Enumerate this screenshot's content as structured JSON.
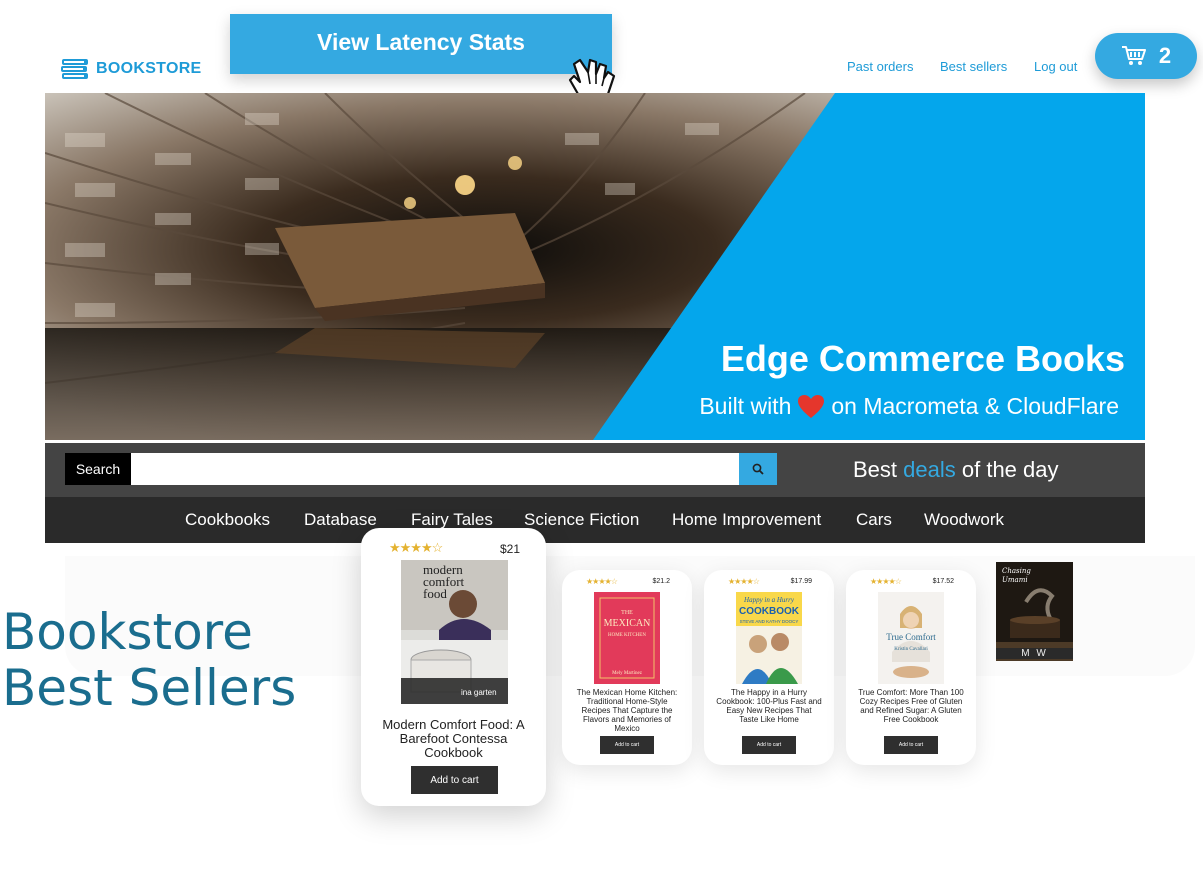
{
  "header": {
    "logo_text": "BOOKSTORE",
    "latency_button": "View Latency Stats",
    "nav": [
      "Past orders",
      "Best sellers",
      "Log out"
    ],
    "cart_count": "2"
  },
  "hero": {
    "title": "Edge Commerce Books",
    "subtitle_prefix": "Built with",
    "subtitle_suffix": "on Macrometa & CloudFlare"
  },
  "search": {
    "label": "Search",
    "placeholder": "",
    "deals_prefix": "Best",
    "deals_highlight": "deals",
    "deals_suffix": "of the day"
  },
  "categories": [
    "Cookbooks",
    "Database",
    "Fairy Tales",
    "Science Fiction",
    "Home Improvement",
    "Cars",
    "Woodwork"
  ],
  "section_title": [
    "Bookstore",
    "Best Sellers"
  ],
  "books": [
    {
      "title": "Modern Comfort Food: A Barefoot Contessa Cookbook",
      "price": "$21",
      "stars": "★★★★☆",
      "add_label": "Add to cart",
      "cover_lines": [
        "modern",
        "comfort",
        "food"
      ],
      "cover_author": "ina garten"
    },
    {
      "title": "The Mexican Home Kitchen: Traditional Home-Style Recipes That Capture the Flavors and Memories of Mexico",
      "price": "$21.2",
      "stars": "★★★★☆",
      "add_label": "Add to cart",
      "cover_lines": [
        "THE",
        "MEXICAN",
        "HOME KITCHEN"
      ],
      "cover_author": "Mely Martínez"
    },
    {
      "title": "The Happy in a Hurry Cookbook: 100-Plus Fast and Easy New Recipes That Taste Like Home",
      "price": "$17.99",
      "stars": "★★★★☆",
      "add_label": "Add to cart",
      "cover_lines": [
        "Happy in a Hurry",
        "COOKBOOK",
        "STEVE AND KATHY DOOCY"
      ],
      "cover_author": ""
    },
    {
      "title": "True Comfort: More Than 100 Cozy Recipes Free of Gluten and Refined Sugar: A Gluten Free Cookbook",
      "price": "$17.52",
      "stars": "★★★★☆",
      "add_label": "Add to cart",
      "cover_lines": [
        "True Comfort"
      ],
      "cover_author": "Kristin Cavallari"
    },
    {
      "cover_lines": [
        "Chasing",
        "Umami"
      ],
      "cover_author": "M W"
    }
  ],
  "colors": {
    "accent": "#34a9e1",
    "title_blue": "#1a6d8e",
    "search_bar": "#444444",
    "category_bar": "#2a2a2a"
  }
}
